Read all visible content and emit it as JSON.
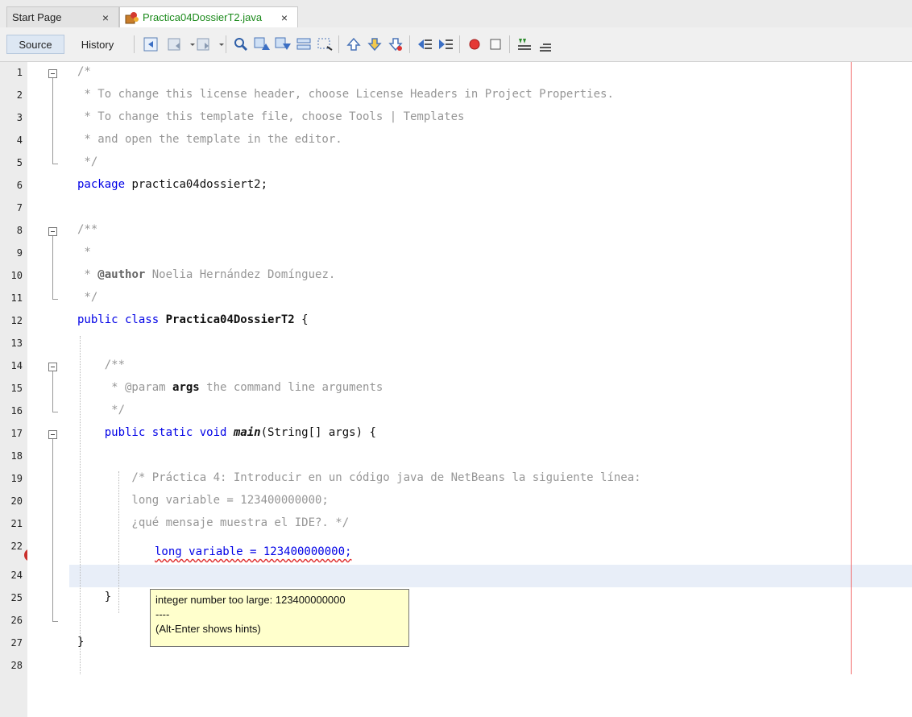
{
  "tabs": [
    {
      "label": "Start Page",
      "close": "×"
    },
    {
      "label": "Practica04DossierT2.java",
      "close": "×"
    }
  ],
  "toolbar": {
    "source_label": "Source",
    "history_label": "History",
    "icons": [
      "back-icon",
      "forward-icon",
      "last-edit-icon",
      "find-icon",
      "find-previous-icon",
      "find-next-icon",
      "toggle-highlight-icon",
      "toggle-rectangular-icon",
      "shift-up-icon",
      "shift-down-icon",
      "toggle-bookmark-icon",
      "shift-left-icon",
      "shift-right-icon",
      "start-macro-icon",
      "stop-macro-icon",
      "comment-icon",
      "uncomment-icon"
    ]
  },
  "editor": {
    "line_numbers": [
      "1",
      "2",
      "3",
      "4",
      "5",
      "6",
      "7",
      "8",
      "9",
      "10",
      "11",
      "12",
      "13",
      "14",
      "15",
      "16",
      "17",
      "18",
      "19",
      "20",
      "21",
      "22",
      "23",
      "24",
      "25",
      "26",
      "27",
      "28"
    ],
    "lines": {
      "l1": "/*",
      "l2": " * To change this license header, choose License Headers in Project Properties.",
      "l3": " * To change this template file, choose Tools | Templates",
      "l4": " * and open the template in the editor.",
      "l5": " */",
      "l6_kw": "package",
      "l6_rest": " practica04dossiert2;",
      "l8": "/**",
      "l9": " *",
      "l10_a": " * ",
      "l10_tag": "@author",
      "l10_rest": " Noelia Hernández Domínguez.",
      "l11": " */",
      "l12_kw": "public class",
      "l12_name": "Practica04DossierT2",
      "l12_rest": " {",
      "l14": "    /**",
      "l15_a": "     * @param ",
      "l15_b": "args",
      "l15_c": " the command line arguments",
      "l16": "     */",
      "l17_kw": "    public static void ",
      "l17_name": "main",
      "l17_rest": "(String[] args) {",
      "l19": "        /* Práctica 4: Introducir en un código java de NetBeans la siguiente línea:",
      "l20": "        long variable = 123400000000;",
      "l21": "        ¿qué mensaje muestra el IDE?. */",
      "l23": "long variable = 123400000000;",
      "l25": "    }",
      "l27": "}"
    },
    "error_mark": "!"
  },
  "tooltip": {
    "line1": "integer number too large: 123400000000",
    "line2": "----",
    "line3": "(Alt-Enter shows hints)"
  }
}
